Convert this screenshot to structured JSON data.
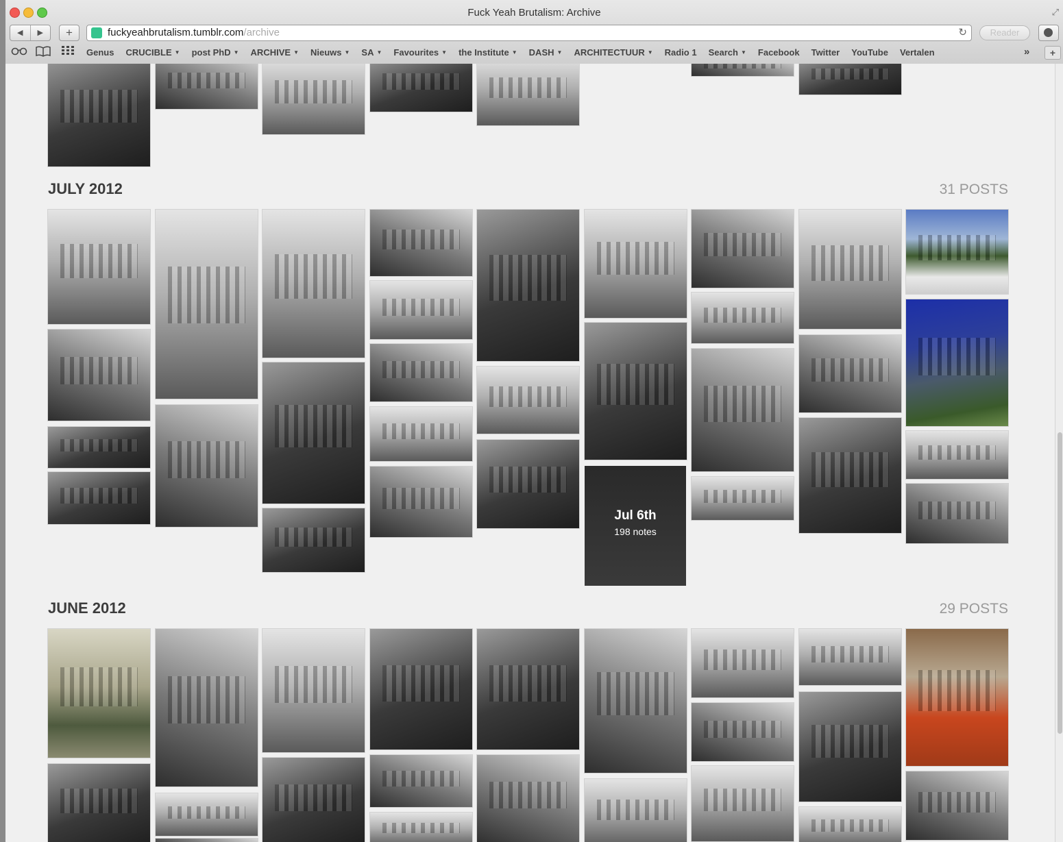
{
  "window": {
    "title": "Fuck Yeah Brutalism: Archive",
    "url_host": "fuckyeahbrutalism.tumblr.com",
    "url_path": "/archive",
    "reader_label": "Reader",
    "back_glyph": "◀",
    "forward_glyph": "▶",
    "plus_glyph": "+",
    "reload_glyph": "↻",
    "resize_glyph": "⤢"
  },
  "bookmarks_bar": {
    "reading_list_icon": "glasses-icon",
    "bookmarks_icon": "book-icon",
    "top_sites_icon": "grid-icon",
    "items": [
      {
        "label": "Genus",
        "menu": false
      },
      {
        "label": "CRUCIBLE",
        "menu": true
      },
      {
        "label": "post PhD",
        "menu": true
      },
      {
        "label": "ARCHIVE",
        "menu": true
      },
      {
        "label": "Nieuws",
        "menu": true
      },
      {
        "label": "SA",
        "menu": true
      },
      {
        "label": "Favourites",
        "menu": true
      },
      {
        "label": "the Institute",
        "menu": true
      },
      {
        "label": "DASH",
        "menu": true
      },
      {
        "label": "ARCHITECTUUR",
        "menu": true
      },
      {
        "label": "Radio 1",
        "menu": false
      },
      {
        "label": "Search",
        "menu": true
      },
      {
        "label": "Facebook",
        "menu": false
      },
      {
        "label": "Twitter",
        "menu": false
      },
      {
        "label": "YouTube",
        "menu": false
      },
      {
        "label": "Vertalen",
        "menu": false
      }
    ],
    "more_glyph": "»",
    "add_glyph": "+"
  },
  "archive": {
    "months": [
      {
        "title": "JULY 2012",
        "count": "31 POSTS"
      },
      {
        "title": "JUNE 2012",
        "count": "29 POSTS"
      }
    ],
    "hover_post": {
      "date": "Jul 6th",
      "notes": "198 notes"
    },
    "photo_tone": "black-and-white architecture photography",
    "colors": {
      "bw_dark": "#2b2b2b",
      "bw_mid": "#8c8c8c",
      "bw_light": "#d8d8d8",
      "sky_blue": "#2d3f9a",
      "orange": "#c8461e",
      "olive": "#a8a58a"
    }
  }
}
